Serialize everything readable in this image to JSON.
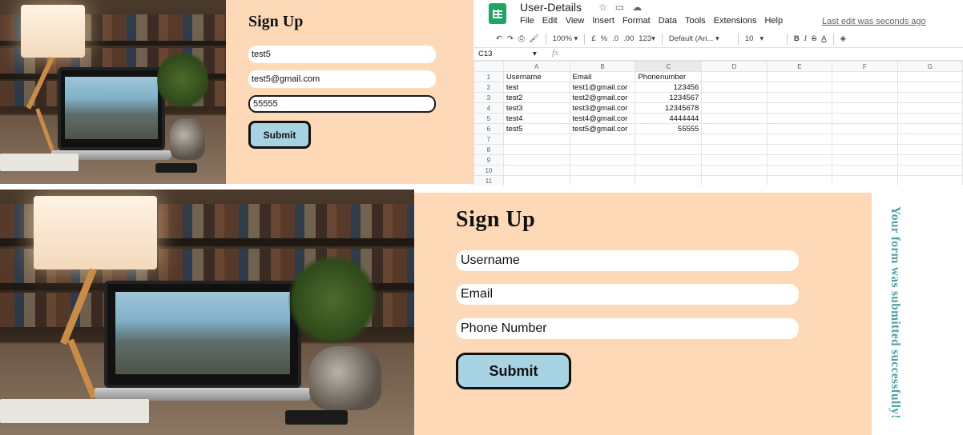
{
  "top_form": {
    "title": "Sign Up",
    "fields": [
      {
        "value": "test5"
      },
      {
        "value": "test5@gmail.com"
      },
      {
        "value": "55555"
      }
    ],
    "submit_label": "Submit"
  },
  "spreadsheet": {
    "doc_title": "User-Details",
    "menu": [
      "File",
      "Edit",
      "View",
      "Insert",
      "Format",
      "Data",
      "Tools",
      "Extensions",
      "Help"
    ],
    "last_edit": "Last edit was seconds ago",
    "toolbar": {
      "zoom": "100%",
      "currency": "£",
      "percent": "%",
      "dec_decrease": ".0",
      "dec_increase": ".00",
      "number_format": "123",
      "font": "Default (Ari...",
      "font_size": "10"
    },
    "name_box": "C13",
    "fx": "fx",
    "columns": [
      "A",
      "B",
      "C",
      "D",
      "E",
      "F",
      "G"
    ],
    "headers": [
      "Username",
      "Email",
      "Phonenumber"
    ],
    "rows": [
      [
        "test",
        "test1@gmail.cor",
        "123456"
      ],
      [
        "test2",
        "test2@gmail.cor",
        "1234567"
      ],
      [
        "test3",
        "test3@gmail.cor",
        "12345678"
      ],
      [
        "test4",
        "test4@gmail.cor",
        "4444444"
      ],
      [
        "test5",
        "test5@gmail.cor",
        "55555"
      ]
    ],
    "row_numbers": [
      "1",
      "2",
      "3",
      "4",
      "5",
      "6",
      "7",
      "8",
      "9",
      "10",
      "11"
    ]
  },
  "large_form": {
    "title": "Sign Up",
    "username_placeholder": "Username",
    "email_placeholder": "Email",
    "phone_placeholder": "Phone Number",
    "submit_label": "Submit"
  },
  "success_message": "Your form was submitted successfully!",
  "colors": {
    "form_background": "#fed9b8",
    "submit_button": "#a7d3e3",
    "success_text": "#4aa3a2",
    "sheets_green": "#1fa463"
  }
}
